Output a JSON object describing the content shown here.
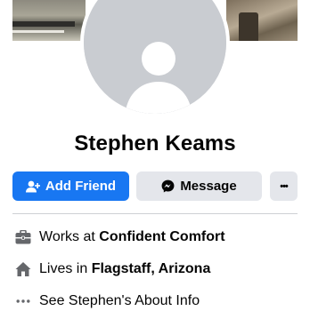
{
  "profile": {
    "name": "Stephen Keams"
  },
  "actions": {
    "add_friend_label": "Add Friend",
    "message_label": "Message",
    "more_label": "•••"
  },
  "intro": {
    "work_prefix": "Works at",
    "work_place": "Confident Comfort",
    "lives_prefix": "Lives in",
    "lives_place": "Flagstaff, Arizona",
    "about_label": "See Stephen's About Info"
  },
  "icons": {
    "add_friend": "person-plus-icon",
    "message": "messenger-icon",
    "more": "more-dots-icon",
    "work": "briefcase-icon",
    "home": "home-icon",
    "about": "ellipsis-icon"
  },
  "colors": {
    "primary": "#1877f2",
    "secondary_button": "#e4e6eb",
    "text": "#050505",
    "icon_gray": "#65676b",
    "avatar_bg": "#c9ccd1"
  }
}
